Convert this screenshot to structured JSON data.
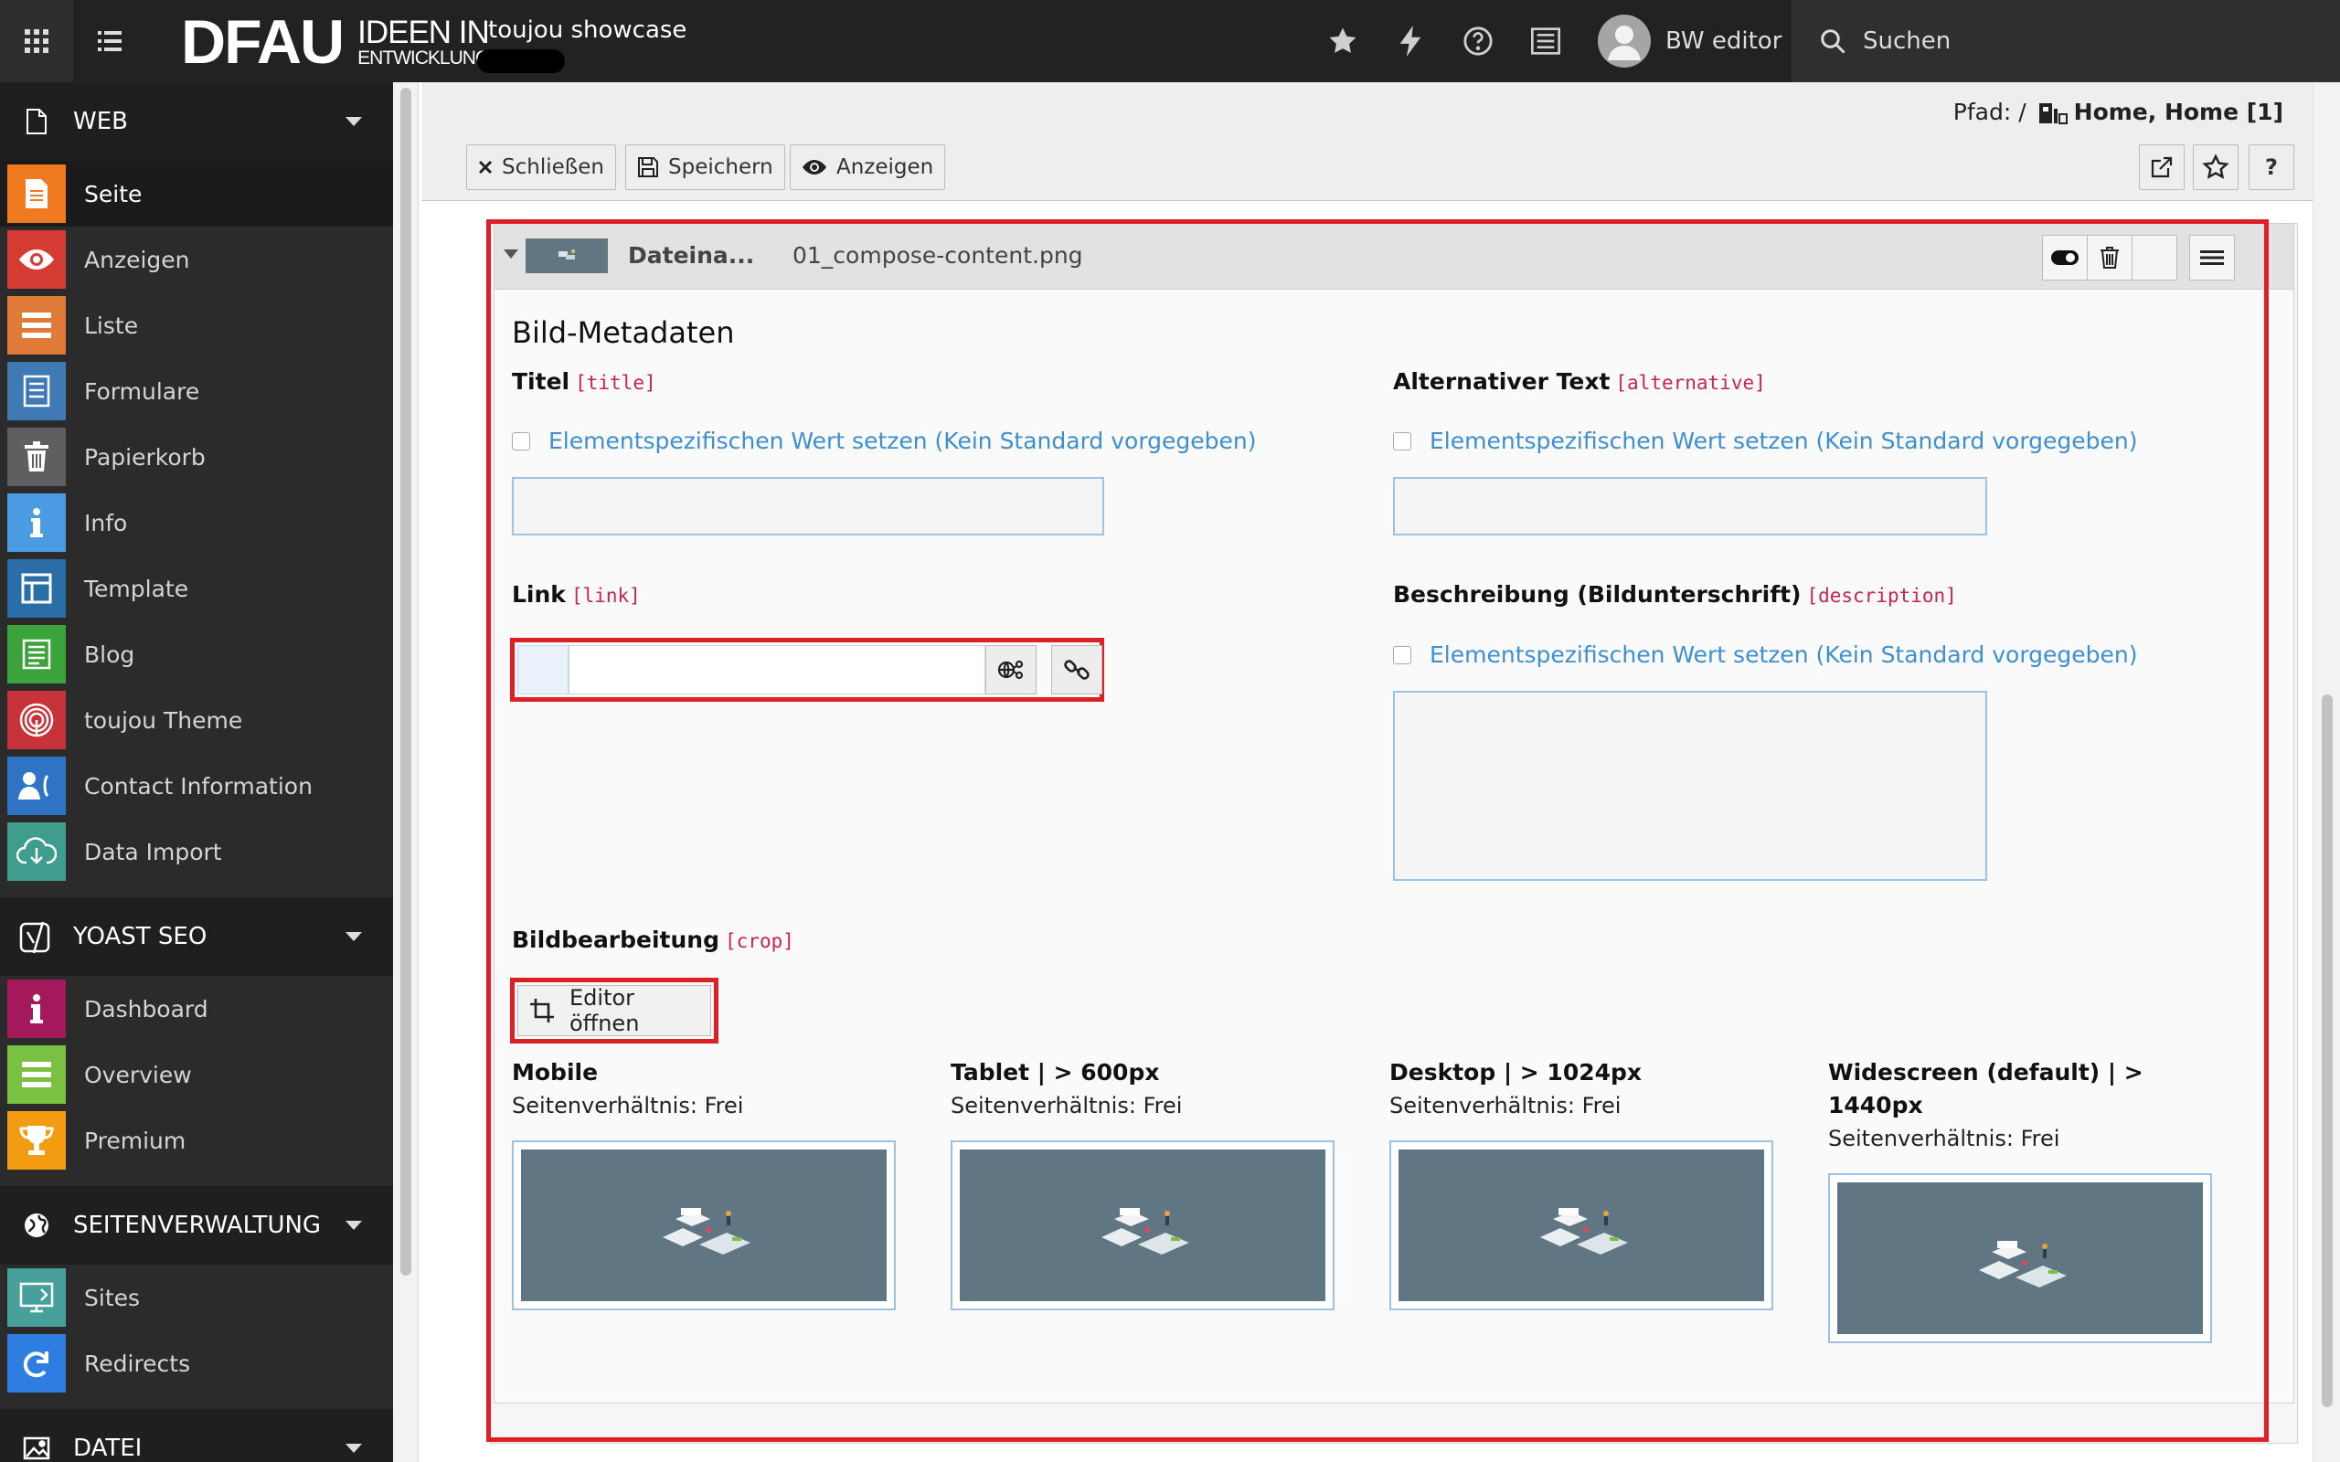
{
  "topbar": {
    "logo_main": "DFAU",
    "logo_line1": "IDEEN IN",
    "logo_line2": "ENTWICKLUNG",
    "site_name": "toujou showcase",
    "user_name": "BW editor",
    "search_label": "Suchen"
  },
  "sidebar": {
    "groups": [
      {
        "label": "WEB",
        "items": [
          {
            "label": "Seite",
            "color": "#f07a1f"
          },
          {
            "label": "Anzeigen",
            "color": "#d43b33"
          },
          {
            "label": "Liste",
            "color": "#e07b3a"
          },
          {
            "label": "Formulare",
            "color": "#3f7ab4"
          },
          {
            "label": "Papierkorb",
            "color": "#5f5f5f"
          },
          {
            "label": "Info",
            "color": "#4a9be2"
          },
          {
            "label": "Template",
            "color": "#2a6ea8"
          },
          {
            "label": "Blog",
            "color": "#3aa33a"
          },
          {
            "label": "toujou Theme",
            "color": "#c8323b"
          },
          {
            "label": "Contact Information",
            "color": "#2e73c4"
          },
          {
            "label": "Data Import",
            "color": "#3f9d8e"
          }
        ]
      },
      {
        "label": "YOAST SEO",
        "items": [
          {
            "label": "Dashboard",
            "color": "#a3195b"
          },
          {
            "label": "Overview",
            "color": "#7ac142"
          },
          {
            "label": "Premium",
            "color": "#f39c12"
          }
        ]
      },
      {
        "label": "SEITENVERWALTUNG",
        "items": [
          {
            "label": "Sites",
            "color": "#47a09b"
          },
          {
            "label": "Redirects",
            "color": "#2d7ee0"
          }
        ]
      },
      {
        "label": "DATEI",
        "items": []
      }
    ]
  },
  "docheader": {
    "path_label": "Pfad: /",
    "path_page": "Home, Home [1]",
    "close_label": "Schließen",
    "save_label": "Speichern",
    "view_label": "Anzeigen",
    "help_label": "?"
  },
  "panel": {
    "header_label": "Dateina...",
    "filename": "01_compose-content.png",
    "section_title": "Bild-Metadaten",
    "title_label": "Titel",
    "title_key": "[title]",
    "alt_label": "Alternativer Text",
    "alt_key": "[alternative]",
    "override_text": "Elementspezifischen Wert setzen (Kein Standard vorgegeben)",
    "link_label": "Link",
    "link_key": "[link]",
    "desc_label": "Beschreibung (Bildunterschrift)",
    "desc_key": "[description]",
    "crop_label": "Bildbearbeitung",
    "crop_key": "[crop]",
    "editor_button": "Editor öffnen",
    "variants": [
      {
        "title": "Mobile",
        "ratio": "Seitenverhältnis: Frei"
      },
      {
        "title": "Tablet | > 600px",
        "ratio": "Seitenverhältnis: Frei"
      },
      {
        "title": "Desktop | > 1024px",
        "ratio": "Seitenverhältnis: Frei"
      },
      {
        "title": "Widescreen (default) | > 1440px",
        "ratio": "Seitenverhältnis: Frei"
      }
    ]
  },
  "colors": {
    "highlight": "#dd1f26",
    "link_blue": "#3d8fd1",
    "key_red": "#c7254e"
  }
}
